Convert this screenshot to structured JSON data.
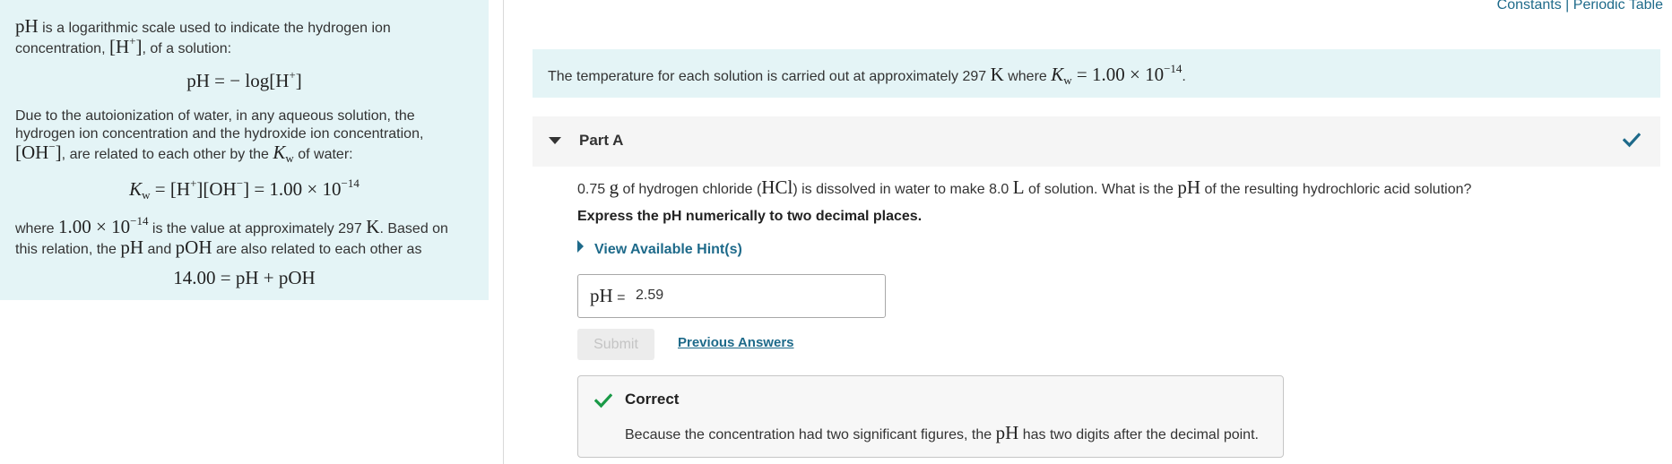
{
  "left_panel": {
    "para1": {
      "lead_math": "pH",
      "text1": " is a logarithmic scale used to indicate the hydrogen ion",
      "text2a": "concentration, ",
      "math_conc": "[H",
      "sup_plus": "+",
      "math_close": "]",
      "text2b": ", of a solution:"
    },
    "eq1": {
      "lhs": "pH = − log[H",
      "sup": "+",
      "rhs": "]"
    },
    "para2": {
      "line1": "Due to the autoionization of water, in any aqueous solution, the",
      "line2": "hydrogen ion concentration and the hydroxide ion concentration,",
      "oh_math": "[OH",
      "oh_sup": "−",
      "oh_close": "]",
      "line3": ", are related to each other by the ",
      "kw_k": "K",
      "kw_sub": "w",
      "line3_end": " of water:"
    },
    "eq2": {
      "k": "K",
      "sub": "w",
      "part1": " = [H",
      "sup1": "+",
      "part2": "][OH",
      "sup2": "−",
      "part3": "] = 1.00 × 10",
      "exp": "−14"
    },
    "para3": {
      "text1": "where ",
      "val": "1.00 × 10",
      "exp": "−14",
      "text2": " is the value at approximately 297 ",
      "unit": "K",
      "text3": ". Based on",
      "text4": "this relation, the ",
      "ph": "pH",
      "and": " and ",
      "poh": "pOH",
      "text5": " are also related to each other as"
    },
    "eq3": "14.00 = pH + pOH"
  },
  "links": {
    "constants": "Constants",
    "separator": "|",
    "periodic_table": "Periodic Table"
  },
  "banner": {
    "text1": "The temperature for each solution is carried out at approximately 297 ",
    "unit": "K",
    "text2": " where ",
    "k": "K",
    "sub": "w",
    "eq": " = 1.00 × 10",
    "exp": "−14",
    "end": "."
  },
  "part": {
    "title": "Part A",
    "status_icon": "checkmark-icon",
    "accent": "#1e6a8a",
    "correct_color": "#1a9a47"
  },
  "question": {
    "t1": "0.75 ",
    "g": "g",
    "t2": " of hydrogen chloride (",
    "hcl": "HCl",
    "t3": ") is dissolved in water to make 8.0 ",
    "l": "L",
    "t4": "  of solution. What is the ",
    "ph": "pH",
    "t5": " of the resulting hydrochloric acid solution?"
  },
  "instruction": "Express the pH numerically to two decimal places.",
  "hint_label": "View Available Hint(s)",
  "answer": {
    "label_math": "pH",
    "label_eq": " = ",
    "value": "2.59"
  },
  "submit_label": "Submit",
  "previous_answers_label": "Previous Answers",
  "feedback": {
    "title": "Correct",
    "t1": "Because the concentration had two significant figures, the ",
    "ph": "pH",
    "t2": " has two digits after the decimal point."
  }
}
